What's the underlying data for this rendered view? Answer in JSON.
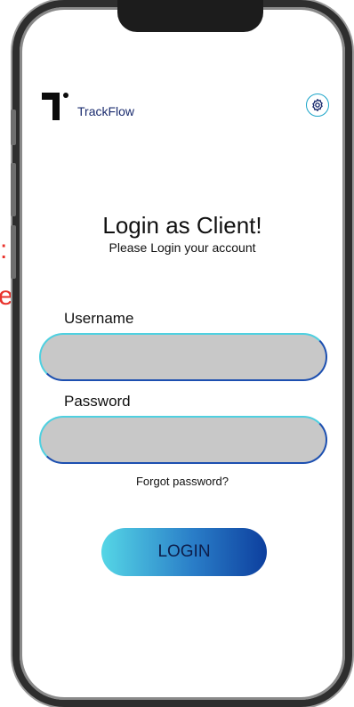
{
  "background_text": {
    "fragment_1": ":",
    "fragment_2": "e'"
  },
  "app": {
    "name": "TrackFlow",
    "settings_icon": "gear-icon"
  },
  "login": {
    "title": "Login as Client!",
    "subtitle": "Please Login your account",
    "username_label": "Username",
    "username_value": "",
    "password_label": "Password",
    "password_value": "",
    "forgot_link": "Forgot password?",
    "submit_label": "LOGIN"
  },
  "colors": {
    "accent_cyan": "#55d6e6",
    "accent_blue": "#0d3f9e",
    "field_fill": "#c8c8c8",
    "background_text_red": "#e8322b"
  }
}
